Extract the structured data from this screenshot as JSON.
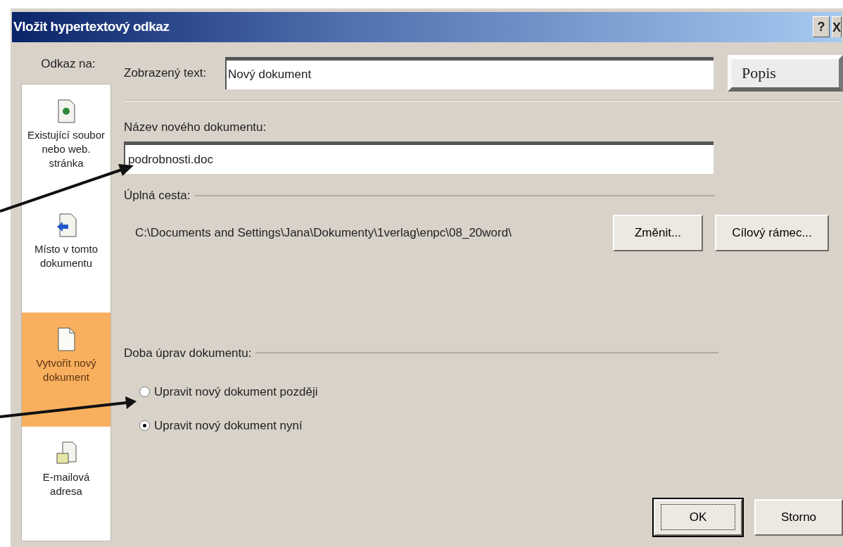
{
  "window": {
    "title": "Vložit hypertextový odkaz",
    "help_button": "?",
    "close_button": "X"
  },
  "sidebar": {
    "label": "Odkaz na:",
    "items": [
      {
        "kind": "file",
        "label": "Existující soubor nebo web. stránka",
        "selected": false
      },
      {
        "kind": "place",
        "label": "Místo v tomto dokumentu",
        "selected": false
      },
      {
        "kind": "new",
        "label": "Vytvořit nový dokument",
        "selected": true
      },
      {
        "kind": "email",
        "label": "E-mailová adresa",
        "selected": false
      }
    ]
  },
  "display_text": {
    "label": "Zobrazený text:",
    "value": "Nový dokument"
  },
  "description_button": "Popis",
  "new_document_name": {
    "label": "Název nového dokumentu:",
    "value": "podrobnosti.doc"
  },
  "full_path": {
    "label": "Úplná cesta:",
    "value": "C:\\Documents and Settings\\Jana\\Dokumenty\\1verlag\\enpc\\08_20word\\"
  },
  "path_buttons": [
    "Změnit...",
    "Cílový rámec..."
  ],
  "edit_time": {
    "label": "Doba úprav dokumentu:",
    "options": [
      {
        "label": "Upravit nový dokument později",
        "selected": false
      },
      {
        "label": "Upravit nový dokument nyní",
        "selected": true
      }
    ]
  },
  "footer_buttons": [
    {
      "label": "OK",
      "default": true
    },
    {
      "label": "Storno",
      "default": false
    }
  ]
}
